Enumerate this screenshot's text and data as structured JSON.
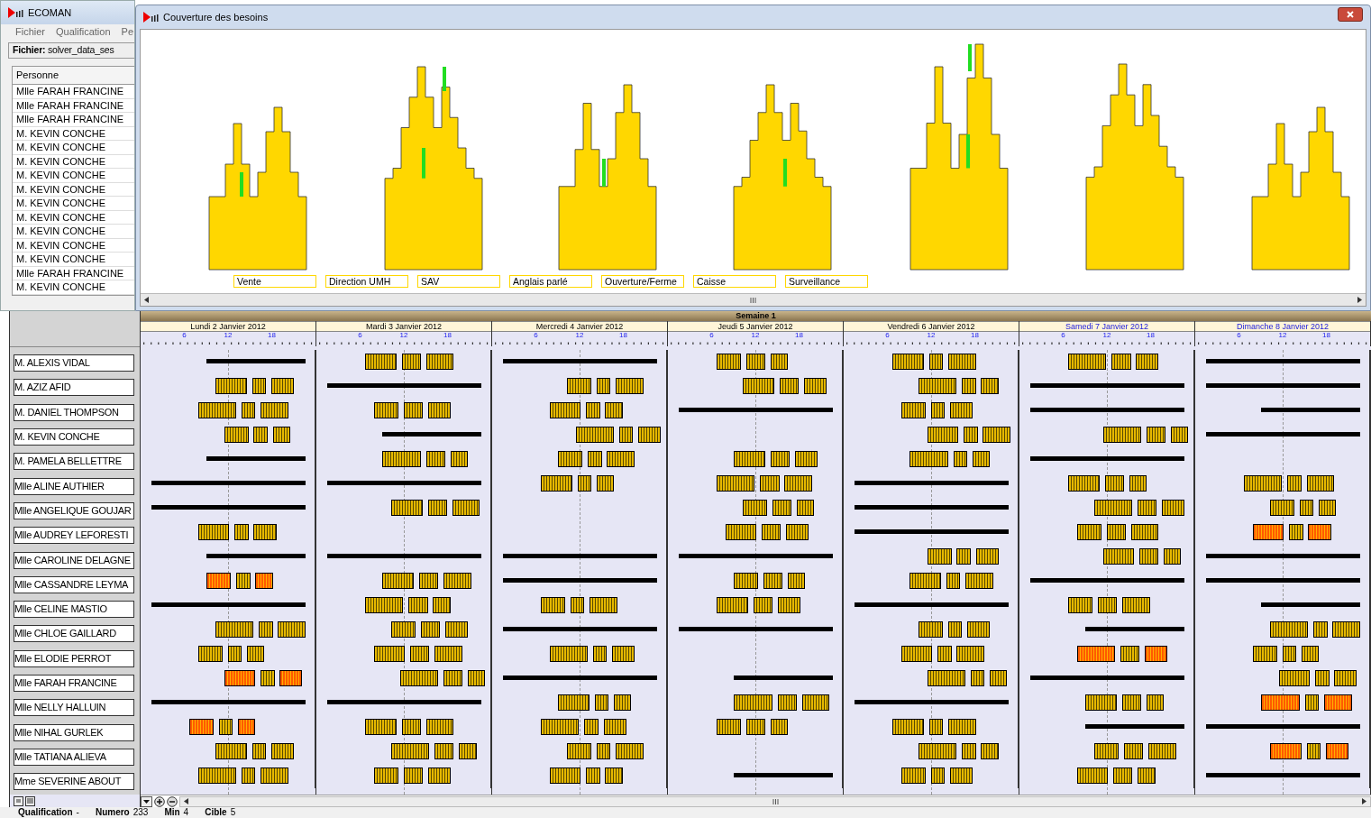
{
  "main_window": {
    "title": "ECOMAN",
    "menu": [
      "Fichier",
      "Qualification",
      "Pe"
    ],
    "file_label": "**Fichier:** solver_data_ses",
    "list_header": "Personne",
    "list_items": [
      "Mlle FARAH FRANCINE",
      "Mlle FARAH FRANCINE",
      "Mlle FARAH FRANCINE",
      "M. KEVIN CONCHE",
      "M. KEVIN CONCHE",
      "M. KEVIN CONCHE",
      "M. KEVIN CONCHE",
      "M. KEVIN CONCHE",
      "M. KEVIN CONCHE",
      "M. KEVIN CONCHE",
      "M. KEVIN CONCHE",
      "M. KEVIN CONCHE",
      "M. KEVIN CONCHE",
      "Mlle FARAH FRANCINE",
      "M. KEVIN CONCHE"
    ]
  },
  "chart_window": {
    "title": "Couverture des besoins",
    "legend": [
      "Vente",
      "Direction UMH",
      "SAV",
      "Anglais parlé",
      "Ouverture/Ferme",
      "Caisse",
      "Surveillance"
    ]
  },
  "planning": {
    "week": "Semaine 1",
    "days": [
      {
        "label": "Lundi 2 Janvier 2012",
        "weekend": false,
        "ticks": [
          "6",
          "12",
          "18"
        ]
      },
      {
        "label": "Mardi 3 Janvier 2012",
        "weekend": false,
        "ticks": [
          "6",
          "12",
          "18"
        ]
      },
      {
        "label": "Mercredi 4 Janvier 2012",
        "weekend": false,
        "ticks": [
          "6",
          "12",
          "18"
        ]
      },
      {
        "label": "Jeudi 5 Janvier 2012",
        "weekend": false,
        "ticks": [
          "6",
          "12",
          "18"
        ]
      },
      {
        "label": "Vendredi 6 Janvier 2012",
        "weekend": false,
        "ticks": [
          "6",
          "12",
          "18"
        ]
      },
      {
        "label": "Samedi 7 Janvier 2012",
        "weekend": true,
        "ticks": [
          "6",
          "12",
          "18"
        ]
      },
      {
        "label": "Dimanche 8 Janvier 2012",
        "weekend": true,
        "ticks": [
          "6",
          "12",
          "18"
        ]
      }
    ],
    "rows": [
      {
        "name": "M. ALEXIS VIDAL",
        "days": [
          {
            "kind": "rest"
          },
          {
            "kind": "work"
          },
          {
            "kind": "rest"
          },
          {
            "kind": "work"
          },
          {
            "kind": "work"
          },
          {
            "kind": "work"
          },
          {
            "kind": "rest"
          }
        ]
      },
      {
        "name": "M. AZIZ AFID",
        "days": [
          {
            "kind": "work"
          },
          {
            "kind": "rest"
          },
          {
            "kind": "work"
          },
          {
            "kind": "work"
          },
          {
            "kind": "work"
          },
          {
            "kind": "rest"
          },
          {
            "kind": "rest"
          }
        ]
      },
      {
        "name": "M. DANIEL THOMPSON",
        "days": [
          {
            "kind": "work"
          },
          {
            "kind": "work"
          },
          {
            "kind": "work"
          },
          {
            "kind": "rest"
          },
          {
            "kind": "work"
          },
          {
            "kind": "rest"
          },
          {
            "kind": "rest"
          }
        ]
      },
      {
        "name": "M. KEVIN CONCHE",
        "days": [
          {
            "kind": "work"
          },
          {
            "kind": "rest"
          },
          {
            "kind": "work"
          },
          {
            "kind": "none"
          },
          {
            "kind": "work"
          },
          {
            "kind": "work"
          },
          {
            "kind": "rest"
          }
        ]
      },
      {
        "name": "M. PAMELA BELLETTRE",
        "days": [
          {
            "kind": "rest"
          },
          {
            "kind": "work"
          },
          {
            "kind": "work"
          },
          {
            "kind": "work"
          },
          {
            "kind": "work"
          },
          {
            "kind": "rest"
          },
          {
            "kind": "none"
          }
        ]
      },
      {
        "name": "Mlle ALINE AUTHIER",
        "days": [
          {
            "kind": "rest"
          },
          {
            "kind": "rest"
          },
          {
            "kind": "work"
          },
          {
            "kind": "work"
          },
          {
            "kind": "rest"
          },
          {
            "kind": "work"
          },
          {
            "kind": "work"
          }
        ]
      },
      {
        "name": "Mlle ANGELIQUE GOUJAR",
        "days": [
          {
            "kind": "rest"
          },
          {
            "kind": "work"
          },
          {
            "kind": "none"
          },
          {
            "kind": "work"
          },
          {
            "kind": "rest"
          },
          {
            "kind": "work"
          },
          {
            "kind": "work"
          }
        ]
      },
      {
        "name": "Mlle AUDREY LEFORESTI",
        "days": [
          {
            "kind": "work"
          },
          {
            "kind": "none"
          },
          {
            "kind": "none"
          },
          {
            "kind": "work"
          },
          {
            "kind": "rest"
          },
          {
            "kind": "work"
          },
          {
            "kind": "alert"
          }
        ]
      },
      {
        "name": "Mlle CAROLINE DELAGNE",
        "days": [
          {
            "kind": "rest"
          },
          {
            "kind": "rest"
          },
          {
            "kind": "rest"
          },
          {
            "kind": "rest"
          },
          {
            "kind": "work"
          },
          {
            "kind": "work"
          },
          {
            "kind": "rest"
          }
        ]
      },
      {
        "name": "Mlle CASSANDRE LEYMA",
        "days": [
          {
            "kind": "alert"
          },
          {
            "kind": "work"
          },
          {
            "kind": "rest"
          },
          {
            "kind": "work"
          },
          {
            "kind": "work"
          },
          {
            "kind": "rest"
          },
          {
            "kind": "rest"
          }
        ]
      },
      {
        "name": "Mlle CELINE MASTIO",
        "days": [
          {
            "kind": "rest"
          },
          {
            "kind": "work"
          },
          {
            "kind": "work"
          },
          {
            "kind": "work"
          },
          {
            "kind": "rest"
          },
          {
            "kind": "work"
          },
          {
            "kind": "rest"
          }
        ]
      },
      {
        "name": "Mlle CHLOE GAILLARD",
        "days": [
          {
            "kind": "work"
          },
          {
            "kind": "work"
          },
          {
            "kind": "rest"
          },
          {
            "kind": "rest"
          },
          {
            "kind": "work"
          },
          {
            "kind": "rest"
          },
          {
            "kind": "work"
          }
        ]
      },
      {
        "name": "Mlle ELODIE PERROT",
        "days": [
          {
            "kind": "work"
          },
          {
            "kind": "work"
          },
          {
            "kind": "work"
          },
          {
            "kind": "none"
          },
          {
            "kind": "work"
          },
          {
            "kind": "alert"
          },
          {
            "kind": "work"
          }
        ]
      },
      {
        "name": "Mlle FARAH FRANCINE",
        "days": [
          {
            "kind": "alert"
          },
          {
            "kind": "work"
          },
          {
            "kind": "rest"
          },
          {
            "kind": "rest"
          },
          {
            "kind": "work"
          },
          {
            "kind": "rest"
          },
          {
            "kind": "work"
          }
        ]
      },
      {
        "name": "Mlle NELLY HALLUIN",
        "days": [
          {
            "kind": "rest"
          },
          {
            "kind": "rest"
          },
          {
            "kind": "work"
          },
          {
            "kind": "work"
          },
          {
            "kind": "rest"
          },
          {
            "kind": "work"
          },
          {
            "kind": "alert"
          }
        ]
      },
      {
        "name": "Mlle NIHAL GURLEK",
        "days": [
          {
            "kind": "alert"
          },
          {
            "kind": "work"
          },
          {
            "kind": "work"
          },
          {
            "kind": "work"
          },
          {
            "kind": "work"
          },
          {
            "kind": "rest"
          },
          {
            "kind": "rest"
          }
        ]
      },
      {
        "name": "Mlle TATIANA ALIEVA",
        "days": [
          {
            "kind": "work"
          },
          {
            "kind": "work"
          },
          {
            "kind": "work"
          },
          {
            "kind": "none"
          },
          {
            "kind": "work"
          },
          {
            "kind": "work"
          },
          {
            "kind": "alert"
          }
        ]
      },
      {
        "name": "Mme SEVERINE ABOUT",
        "days": [
          {
            "kind": "work"
          },
          {
            "kind": "work"
          },
          {
            "kind": "work"
          },
          {
            "kind": "rest"
          },
          {
            "kind": "work"
          },
          {
            "kind": "work"
          },
          {
            "kind": "rest"
          }
        ]
      }
    ]
  },
  "status_bar": [
    {
      "label": "Qualification",
      "value": "-"
    },
    {
      "label": "Numero",
      "value": "233"
    },
    {
      "label": "Min",
      "value": "4"
    },
    {
      "label": "Cible",
      "value": "5"
    }
  ]
}
